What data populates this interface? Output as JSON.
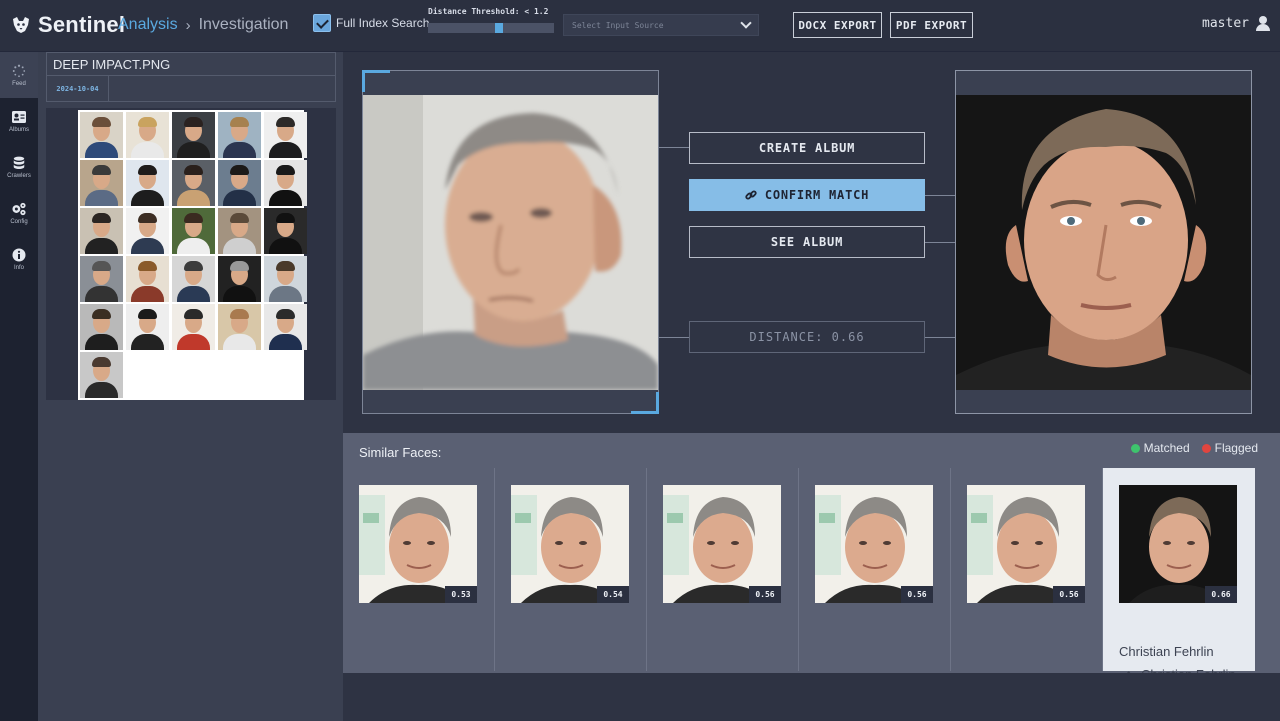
{
  "app": {
    "name": "Sentinel"
  },
  "breadcrumb": {
    "section": "Analysis",
    "separator": "›",
    "page": "Investigation"
  },
  "toolbar": {
    "full_index_search": {
      "label": "Full Index Search",
      "checked": true
    },
    "distance_threshold": {
      "label": "Distance Threshold: < 1.2",
      "value_fraction": 0.57
    },
    "input_source": {
      "placeholder": "Select Input Source"
    },
    "docx_export": "DOCX EXPORT",
    "pdf_export": "PDF EXPORT"
  },
  "user": {
    "name": "master"
  },
  "nav": [
    {
      "label": "Feed",
      "icon": "spinner-icon",
      "active": true
    },
    {
      "label": "Albums",
      "icon": "album-icon",
      "active": false
    },
    {
      "label": "Crawlers",
      "icon": "database-icon",
      "active": false
    },
    {
      "label": "Config",
      "icon": "gears-icon",
      "active": false
    },
    {
      "label": "Info",
      "icon": "info-icon",
      "active": false
    }
  ],
  "file": {
    "name": "DEEP IMPACT.PNG",
    "date": "2024-10-04"
  },
  "portrait_grid_count": 26,
  "compare": {
    "create_album": "CREATE ALBUM",
    "confirm_match": "CONFIRM MATCH",
    "see_album": "SEE ALBUM",
    "distance": "DISTANCE: 0.66"
  },
  "similar": {
    "title": "Similar Faces:",
    "legend": [
      {
        "label": "Matched",
        "color": "#3ec46d"
      },
      {
        "label": "Flagged",
        "color": "#e0453f"
      }
    ],
    "items": [
      {
        "score": "0.53"
      },
      {
        "score": "0.54"
      },
      {
        "score": "0.56"
      },
      {
        "score": "0.56"
      },
      {
        "score": "0.56"
      },
      {
        "score": "0.66",
        "name": "Christian Fehrlin",
        "album": "Christian Fehrlin",
        "selected": true
      }
    ]
  },
  "colors": {
    "accent": "#5aa9e0",
    "confirm": "#86bde7",
    "background": "#2c3142"
  }
}
